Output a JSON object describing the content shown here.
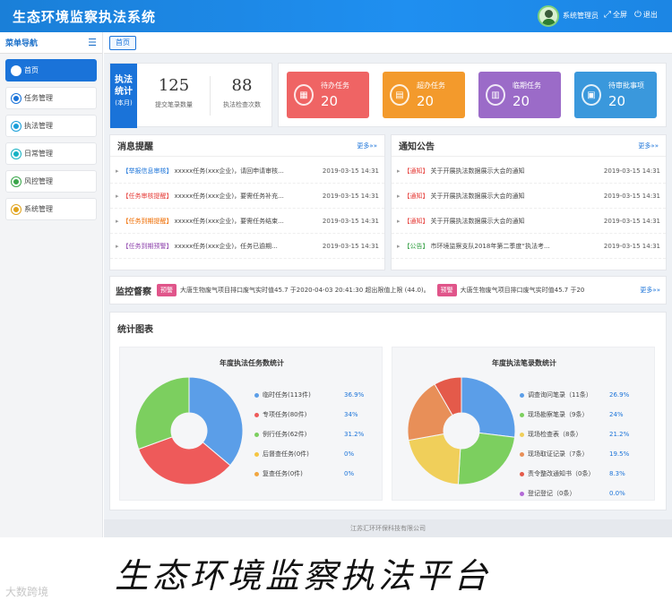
{
  "header": {
    "title": "生态环境监察执法系统",
    "user": "系统管理员",
    "fullscreen": "全屏",
    "logout": "退出"
  },
  "sidebar": {
    "title": "菜单导航",
    "items": [
      {
        "label": "首页",
        "color": "#1a73d9"
      },
      {
        "label": "任务管理",
        "color": "#1a73d9"
      },
      {
        "label": "执法管理",
        "color": "#1a9fd9"
      },
      {
        "label": "日常管理",
        "color": "#17b2c4"
      },
      {
        "label": "风控管理",
        "color": "#3aa64a"
      },
      {
        "label": "系统管理",
        "color": "#e0a21a"
      }
    ]
  },
  "tab": "首页",
  "stats": {
    "label": "执法统计",
    "sublabel": "(本月)",
    "items": [
      {
        "value": "125",
        "caption": "提交笔录数量"
      },
      {
        "value": "88",
        "caption": "执法检查次数"
      }
    ]
  },
  "cards": [
    {
      "title": "待办任务",
      "value": "20",
      "color": "#ef6464",
      "icon": "calendar-icon"
    },
    {
      "title": "超办任务",
      "value": "20",
      "color": "#f39a2c",
      "icon": "document-icon"
    },
    {
      "title": "临期任务",
      "value": "20",
      "color": "#9b6bc8",
      "icon": "clipboard-icon"
    },
    {
      "title": "待审批事项",
      "value": "20",
      "color": "#3a98dc",
      "icon": "approval-icon"
    }
  ],
  "messages": {
    "title": "消息提醒",
    "more": "更多»»",
    "rows": [
      {
        "tag": "【举报信息审核】",
        "tag_color": "#1a73d9",
        "text": "xxxxx任务(xxx企业)，请回申请审核...",
        "time": "2019-03-15 14:31"
      },
      {
        "tag": "【任务审核提醒】",
        "tag_color": "#e53935",
        "text": "xxxxx任务(xxx企业)，要需任务补充...",
        "time": "2019-03-15 14:31"
      },
      {
        "tag": "【任务到期提醒】",
        "tag_color": "#ef6c00",
        "text": "xxxxx任务(xxx企业)，要需任务结束...",
        "time": "2019-03-15 14:31"
      },
      {
        "tag": "【任务到期预警】",
        "tag_color": "#8e44ad",
        "text": "xxxxx任务(xxx企业)，任务已逾期...",
        "time": "2019-03-15 14:31"
      }
    ]
  },
  "notices": {
    "title": "通知公告",
    "more": "更多»»",
    "rows": [
      {
        "tag": "【通知】",
        "tag_color": "#e53935",
        "text": "关于开展执法数据展示大会的通知",
        "time": "2019-03-15 14:31"
      },
      {
        "tag": "【通知】",
        "tag_color": "#e53935",
        "text": "关于开展执法数据展示大会的通知",
        "time": "2019-03-15 14:31"
      },
      {
        "tag": "【通知】",
        "tag_color": "#e53935",
        "text": "关于开展执法数据展示大会的通知",
        "time": "2019-03-15 14:31"
      },
      {
        "tag": "【公告】",
        "tag_color": "#2e9d3f",
        "text": "市环境监察支队2018年第二季度“执法考...",
        "time": "2019-03-15 14:31"
      }
    ]
  },
  "monitor": {
    "title": "监控督察",
    "warn_label": "预警",
    "items": [
      "大唐生物废气项目排口废气实时值45.7 于2020-04-03 20:41:30 超出限值上限 (44.0)。",
      "大唐生物废气项目排口废气实时值45.7 于20"
    ],
    "more": "更多»»"
  },
  "charts": {
    "title": "统计图表",
    "left": {
      "title": "年度执法任务数统计",
      "items": [
        {
          "label": "临时任务(113件)",
          "value": 36.9,
          "pct": "36.9%",
          "color": "#5b9ee8"
        },
        {
          "label": "专项任务(80件)",
          "value": 34,
          "pct": "34%",
          "color": "#ee5a5a"
        },
        {
          "label": "例行任务(62件)",
          "value": 31.2,
          "pct": "31.2%",
          "color": "#7ccf5f"
        },
        {
          "label": "后督查任务(0件)",
          "value": 0,
          "pct": "0%",
          "color": "#f5c542"
        },
        {
          "label": "复查任务(0件)",
          "value": 0,
          "pct": "0%",
          "color": "#f1a640"
        }
      ]
    },
    "right": {
      "title": "年度执法笔录数统计",
      "items": [
        {
          "label": "调查询问笔录（11条）",
          "value": 26.9,
          "pct": "26.9%",
          "color": "#5b9ee8"
        },
        {
          "label": "现场勘察笔录（9条）",
          "value": 24,
          "pct": "24%",
          "color": "#7ccf5f"
        },
        {
          "label": "现场检查表（8条）",
          "value": 21.2,
          "pct": "21.2%",
          "color": "#f0cf5a"
        },
        {
          "label": "现场取证记录（7条）",
          "value": 19.5,
          "pct": "19.5%",
          "color": "#e88f58"
        },
        {
          "label": "责令整改通知书（0条）",
          "value": 8.3,
          "pct": "8.3%",
          "color": "#e45a4a"
        },
        {
          "label": "登记登记（0条）",
          "value": 0,
          "pct": "0.0%",
          "color": "#b36ad6"
        }
      ]
    }
  },
  "footer": "江苏汇环环保科技有限公司",
  "caption": "生态环境监察执法平台",
  "watermark": "大数跨境"
}
